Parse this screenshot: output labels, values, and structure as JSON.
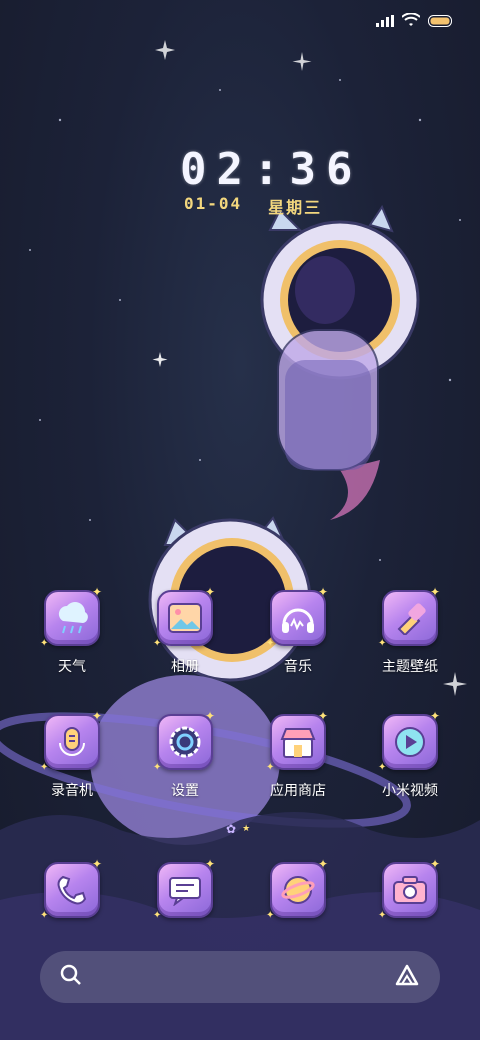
{
  "status_bar": {
    "signal": "signal-icon",
    "wifi": "wifi-icon",
    "battery": "battery-icon"
  },
  "clock": {
    "time": "02:36",
    "date": "01-04",
    "weekday": "星期三"
  },
  "apps": [
    {
      "label": "天气",
      "icon": "weather-icon"
    },
    {
      "label": "相册",
      "icon": "gallery-icon"
    },
    {
      "label": "音乐",
      "icon": "music-icon"
    },
    {
      "label": "主题壁纸",
      "icon": "theme-brush-icon"
    },
    {
      "label": "录音机",
      "icon": "recorder-icon"
    },
    {
      "label": "设置",
      "icon": "settings-icon"
    },
    {
      "label": "应用商店",
      "icon": "app-store-icon"
    },
    {
      "label": "小米视频",
      "icon": "video-play-icon"
    }
  ],
  "dock": [
    {
      "icon": "phone-icon"
    },
    {
      "icon": "messages-icon"
    },
    {
      "icon": "browser-icon"
    },
    {
      "icon": "camera-icon"
    }
  ],
  "search": {
    "left_icon": "search-icon",
    "right_icon": "assistant-icon"
  },
  "colors": {
    "accent": "#f3d77e",
    "icon_purple": "#b784ee"
  }
}
